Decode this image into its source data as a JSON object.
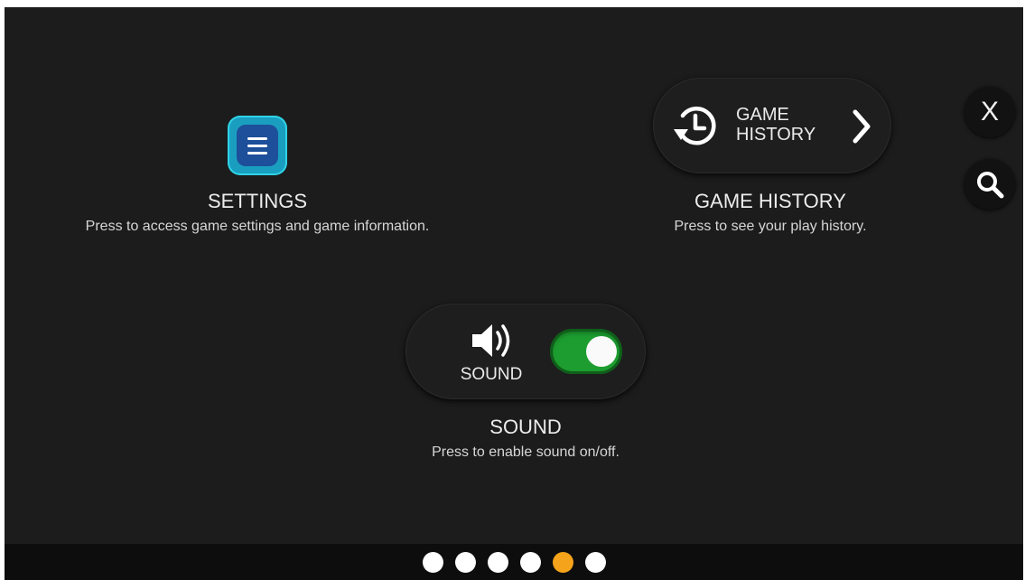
{
  "settings": {
    "title": "SETTINGS",
    "description": "Press to access game settings and game information."
  },
  "history": {
    "button_line1": "GAME",
    "button_line2": "HISTORY",
    "title": "GAME HISTORY",
    "description": "Press to see your play history."
  },
  "sound": {
    "button_label": "SOUND",
    "toggle_on": true,
    "title": "SOUND",
    "description": "Press to enable sound on/off."
  },
  "side": {
    "close_label": "X",
    "search_icon": "search-icon"
  },
  "pager": {
    "pages": 6,
    "active_index": 4
  },
  "colors": {
    "settings_button": "#1a9ec0",
    "toggle_on": "#1d9d2f",
    "active_dot": "#f5a31a",
    "background": "#1c1c1c"
  }
}
